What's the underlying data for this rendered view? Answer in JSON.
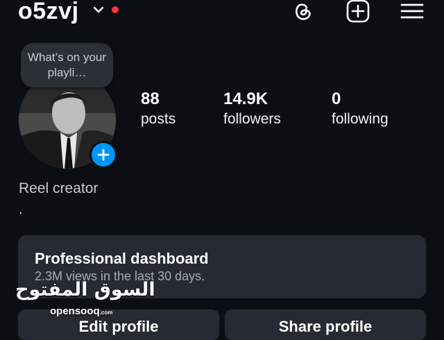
{
  "header": {
    "username": "o5zvj",
    "icons": [
      "chevron-down-icon",
      "notification-dot",
      "threads-icon",
      "new-post-icon",
      "menu-icon"
    ],
    "notification_color": "#ff3040"
  },
  "note": {
    "text": "What’s on your playli…"
  },
  "stats": [
    {
      "value": "88",
      "label": "posts"
    },
    {
      "value": "14.9K",
      "label": "followers"
    },
    {
      "value": "0",
      "label": "following"
    }
  ],
  "bio": {
    "category": "Reel creator",
    "line2": "."
  },
  "dashboard": {
    "title": "Professional dashboard",
    "subtitle": "2.3M views in the last 30 days."
  },
  "buttons": {
    "edit": "Edit profile",
    "share": "Share profile"
  },
  "watermark": {
    "arabic": "السوق المفتوح",
    "latin": "opensooq",
    "suffix": ".com"
  },
  "colors": {
    "background": "#0b0f14",
    "card": "#262b33",
    "accent": "#0095f6"
  }
}
